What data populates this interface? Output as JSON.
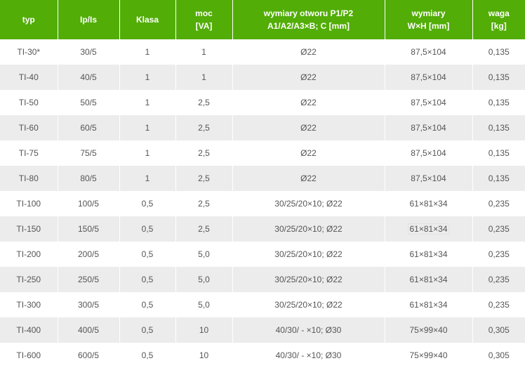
{
  "table": {
    "headers": [
      [
        "typ"
      ],
      [
        "Ip/Is"
      ],
      [
        "Klasa"
      ],
      [
        "moc",
        "[VA]"
      ],
      [
        "wymiary otworu P1/P2",
        "A1/A2/A3×B; C [mm]"
      ],
      [
        "wymiary",
        "W×H [mm]"
      ],
      [
        "waga",
        "[kg]"
      ]
    ],
    "rows": [
      [
        "TI-30*",
        "30/5",
        "1",
        "1",
        "Ø22",
        "87,5×104",
        "0,135"
      ],
      [
        "TI-40",
        "40/5",
        "1",
        "1",
        "Ø22",
        "87,5×104",
        "0,135"
      ],
      [
        "TI-50",
        "50/5",
        "1",
        "2,5",
        "Ø22",
        "87,5×104",
        "0,135"
      ],
      [
        "TI-60",
        "60/5",
        "1",
        "2,5",
        "Ø22",
        "87,5×104",
        "0,135"
      ],
      [
        "TI-75",
        "75/5",
        "1",
        "2,5",
        "Ø22",
        "87,5×104",
        "0,135"
      ],
      [
        "TI-80",
        "80/5",
        "1",
        "2,5",
        "Ø22",
        "87,5×104",
        "0,135"
      ],
      [
        "TI-100",
        "100/5",
        "0,5",
        "2,5",
        "30/25/20×10; Ø22",
        "61×81×34",
        "0,235"
      ],
      [
        "TI-150",
        "150/5",
        "0,5",
        "2,5",
        "30/25/20×10; Ø22",
        "61×81×34",
        "0,235"
      ],
      [
        "TI-200",
        "200/5",
        "0,5",
        "5,0",
        "30/25/20×10; Ø22",
        "61×81×34",
        "0,235"
      ],
      [
        "TI-250",
        "250/5",
        "0,5",
        "5,0",
        "30/25/20×10; Ø22",
        "61×81×34",
        "0,235"
      ],
      [
        "TI-300",
        "300/5",
        "0,5",
        "5,0",
        "30/25/20×10; Ø22",
        "61×81×34",
        "0,235"
      ],
      [
        "TI-400",
        "400/5",
        "0,5",
        "10",
        "40/30/ - ×10; Ø30",
        "75×99×40",
        "0,305"
      ],
      [
        "TI-600",
        "600/5",
        "0,5",
        "10",
        "40/30/ - ×10; Ø30",
        "75×99×40",
        "0,305"
      ]
    ]
  }
}
